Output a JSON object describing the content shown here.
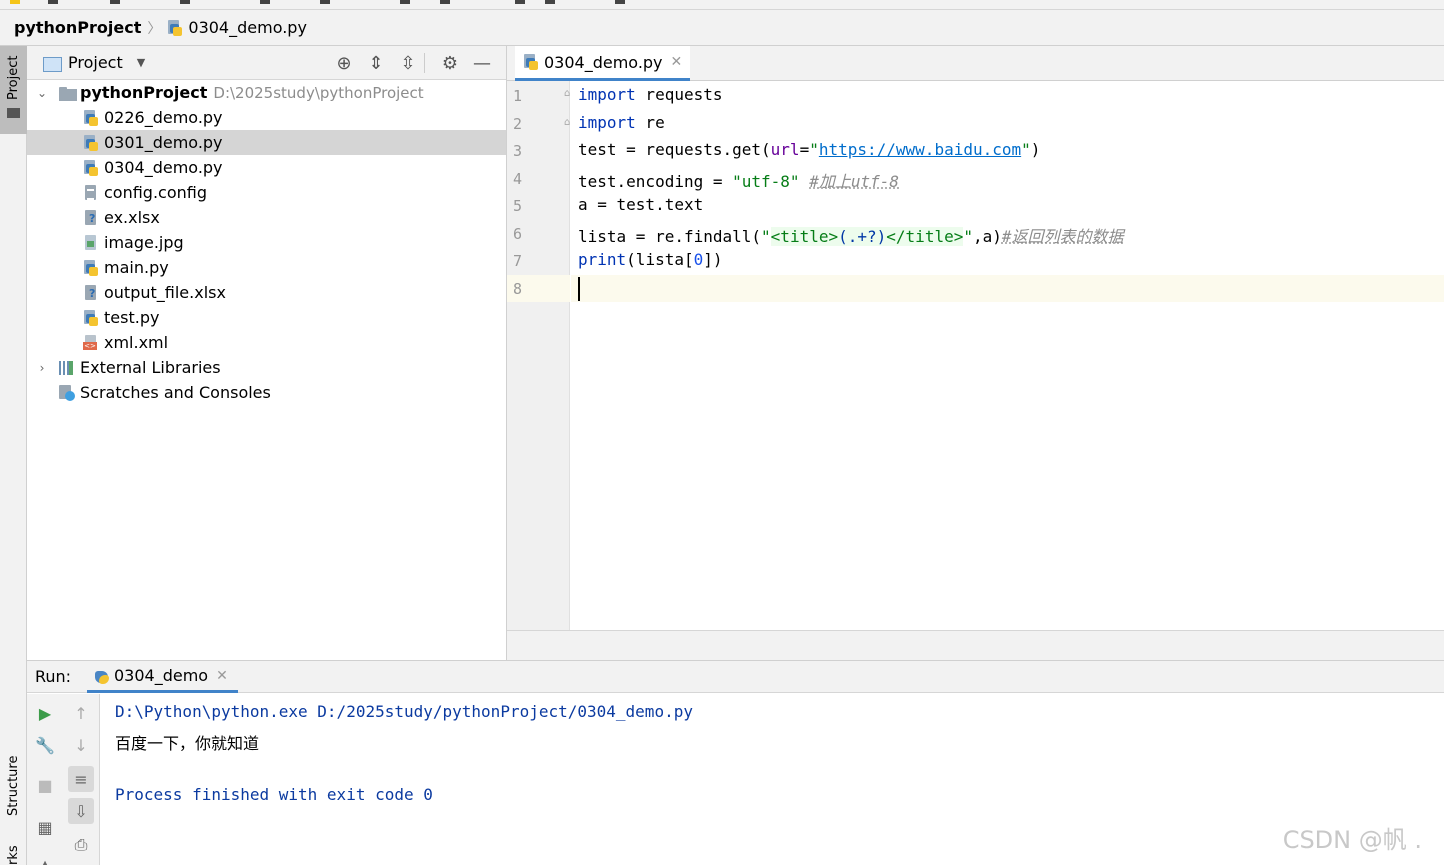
{
  "breadcrumb": {
    "project": "pythonProject",
    "file": "0304_demo.py"
  },
  "left_strip": {
    "project_label": "Project",
    "structure_label": "Structure",
    "bookmarks_label": "rks"
  },
  "project_panel": {
    "title": "Project",
    "root": {
      "name": "pythonProject",
      "path": "D:\\2025study\\pythonProject"
    },
    "files": [
      {
        "name": "0226_demo.py",
        "icon": "python-file-icon"
      },
      {
        "name": "0301_demo.py",
        "icon": "python-file-icon",
        "selected": true
      },
      {
        "name": "0304_demo.py",
        "icon": "python-file-icon"
      },
      {
        "name": "config.config",
        "icon": "text-file-icon"
      },
      {
        "name": "ex.xlsx",
        "icon": "unknown-file-icon"
      },
      {
        "name": "image.jpg",
        "icon": "image-file-icon"
      },
      {
        "name": "main.py",
        "icon": "python-file-icon"
      },
      {
        "name": "output_file.xlsx",
        "icon": "unknown-file-icon"
      },
      {
        "name": "test.py",
        "icon": "python-file-icon"
      },
      {
        "name": "xml.xml",
        "icon": "xml-file-icon"
      }
    ],
    "external_libraries": "External Libraries",
    "scratches": "Scratches and Consoles"
  },
  "editor": {
    "tab": "0304_demo.py",
    "line_numbers": [
      "1",
      "2",
      "3",
      "4",
      "5",
      "6",
      "7",
      "8"
    ],
    "code": {
      "l1_kw": "import",
      "l1_rest": " requests",
      "l2_kw": "import",
      "l2_rest": " re",
      "l3_a": "test = requests.get(",
      "l3_param": "url",
      "l3_eq": "=",
      "l3_q1": "\"",
      "l3_url": "https://www.baidu.com",
      "l3_q2": "\"",
      "l3_end": ")",
      "l4_a": "test.encoding = ",
      "l4_str": "\"utf-8\"",
      "l4_sp": " ",
      "l4_cmt": "#加上utf-8",
      "l5": "a = test.text",
      "l6_a": "lista = re.findall(",
      "l6_q1": "\"",
      "l6_r1": "<title>",
      "l6_r2": "(.+?)",
      "l6_r3": "</title>",
      "l6_q2": "\"",
      "l6_b": ",a)",
      "l6_cmt": "#返回列表的数据",
      "l7_kw": "print",
      "l7_a": "(lista[",
      "l7_num": "0",
      "l7_b": "])"
    }
  },
  "run_panel": {
    "label": "Run:",
    "tab": "0304_demo",
    "output": [
      "D:\\Python\\python.exe D:/2025study/pythonProject/0304_demo.py",
      "百度一下，你就知道",
      "",
      "Process finished with exit code 0"
    ]
  },
  "watermark": "CSDN @帆 ."
}
